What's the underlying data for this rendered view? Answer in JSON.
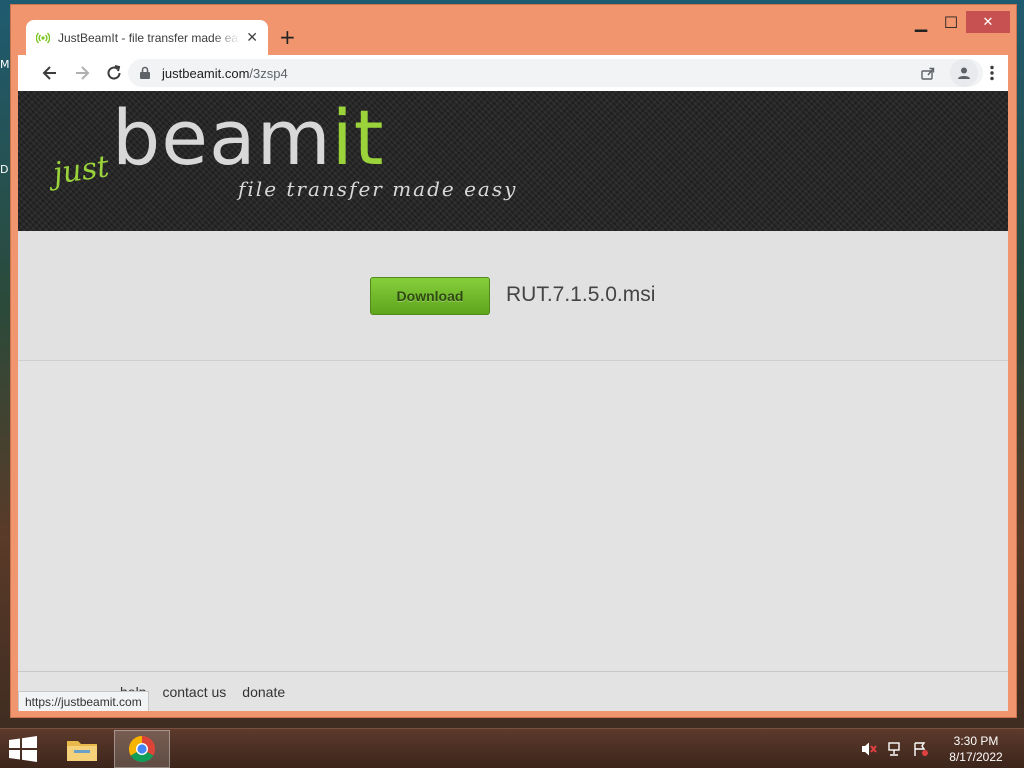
{
  "desktop": {
    "edge_glyphs": [
      "M",
      "D"
    ]
  },
  "window": {
    "controls": {
      "minimize": "▁",
      "maximize": "☐",
      "close": "✕"
    }
  },
  "tab": {
    "title": "JustBeamIt - file transfer made easy",
    "favicon": "signal-icon",
    "close_glyph": "✕",
    "new_tab_glyph": "+"
  },
  "toolbar": {
    "url_host": "justbeamit.com",
    "url_path": "/3zsp4"
  },
  "page": {
    "logo": {
      "just": "just",
      "beam": "beam",
      "it": "it",
      "tagline": "file transfer made easy"
    },
    "download_button": "Download",
    "file_name": "RUT.7.1.5.0.msi",
    "footer_links": [
      "help",
      "contact us",
      "donate"
    ],
    "status_url": "https://justbeamit.com"
  },
  "taskbar": {
    "apps": [
      "file-explorer-icon",
      "chrome-icon"
    ],
    "tray_icons": [
      "volume-muted-icon",
      "network-icon",
      "flag-alert-icon"
    ],
    "clock": {
      "time": "3:30 PM",
      "date": "8/17/2022"
    }
  },
  "colors": {
    "window_frame": "#f0956d",
    "brand_green": "#9bd33a",
    "button_green": "#6fb82a"
  }
}
